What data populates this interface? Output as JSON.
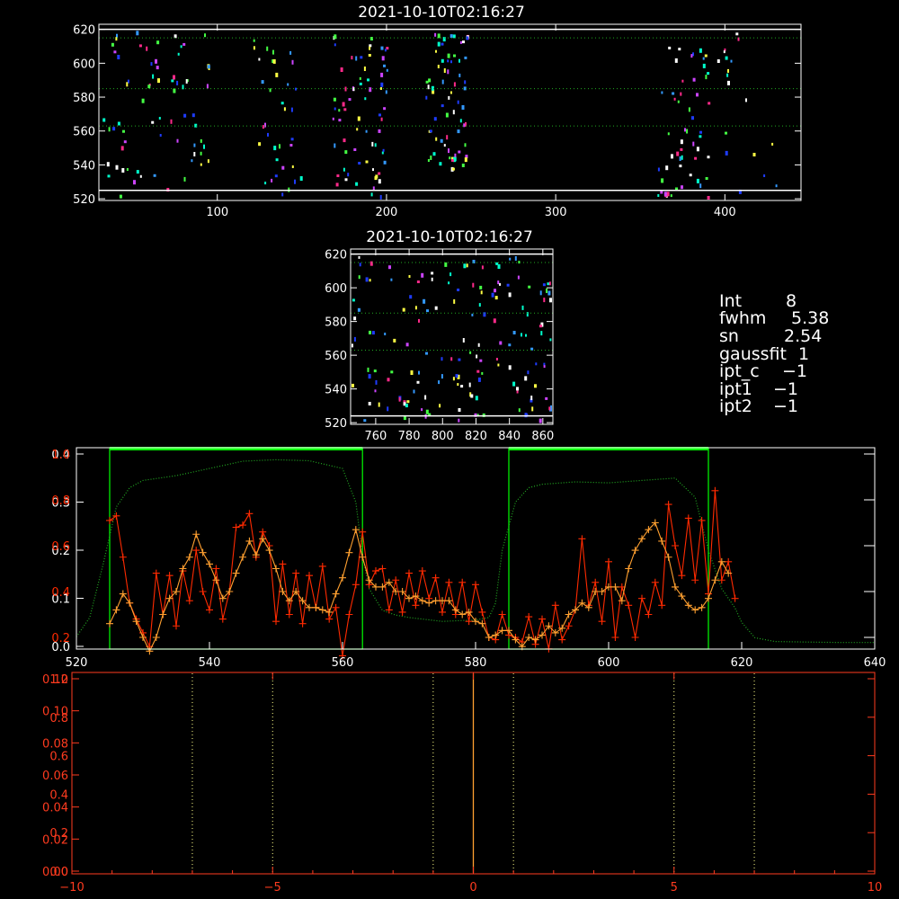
{
  "colors": {
    "background": "#000000",
    "axis_white": "#ffffff",
    "axis_red": "#ff3b1f",
    "guide_green": "#22aa22",
    "box_green": "#00ff00",
    "series_red": "#ff2a00",
    "series_orange": "#ffa030",
    "guide_yellow": "#ffff88",
    "center_orange": "#ffa030",
    "speckle_palette": [
      "#1e3cff",
      "#3399ff",
      "#00ffcc",
      "#44ff44",
      "#cc44ff",
      "#ff2a8a",
      "#ffffff",
      "#ffff44"
    ]
  },
  "info_panel": {
    "lines": [
      {
        "label": "Int",
        "value": "8"
      },
      {
        "label": "fwhm",
        "value": "5.38"
      },
      {
        "label": "sn",
        "value": "2.54"
      },
      {
        "label": "gaussfit",
        "value": "1"
      },
      {
        "label": "ipt_c",
        "value": "−1"
      },
      {
        "label": "ipt1",
        "value": "−1"
      },
      {
        "label": "ipt2",
        "value": "−1"
      }
    ]
  },
  "chart_data": [
    {
      "id": "top-image",
      "type": "heatmap",
      "title": "2021-10-10T02:16:27",
      "xlim": [
        30,
        445
      ],
      "ylim": [
        519,
        623
      ],
      "xticks": [
        100,
        200,
        300,
        400
      ],
      "yticks": [
        520,
        540,
        560,
        580,
        600,
        620
      ],
      "white_lines_y": [
        620,
        525
      ],
      "dotted_green_lines_y": [
        615,
        585,
        563
      ],
      "speckle_columns": [
        {
          "x": [
            30,
            50
          ],
          "y": [
            521,
            620
          ],
          "count": 20
        },
        {
          "x": [
            50,
            95
          ],
          "y": [
            521,
            620
          ],
          "count": 50
        },
        {
          "x": [
            120,
            150
          ],
          "y": [
            521,
            620
          ],
          "count": 35
        },
        {
          "x": [
            168,
            200
          ],
          "y": [
            521,
            620
          ],
          "count": 70
        },
        {
          "x": [
            223,
            248
          ],
          "y": [
            538,
            620
          ],
          "count": 70
        },
        {
          "x": [
            360,
            390
          ],
          "y": [
            521,
            620
          ],
          "count": 55
        },
        {
          "x": [
            395,
            432
          ],
          "y": [
            521,
            620
          ],
          "count": 18
        }
      ]
    },
    {
      "id": "zoom-image",
      "type": "heatmap",
      "title": "2021-10-10T02:16:27",
      "xlim": [
        745,
        866
      ],
      "ylim": [
        519,
        623
      ],
      "xticks": [
        760,
        780,
        800,
        820,
        840,
        860
      ],
      "yticks": [
        520,
        540,
        560,
        580,
        600,
        620
      ],
      "white_lines_y": [
        620,
        524
      ],
      "dotted_green_lines_y": [
        615,
        585,
        563
      ],
      "speckle_count": 160
    },
    {
      "id": "profile-plot",
      "type": "line",
      "xlim": [
        520,
        640
      ],
      "xticks": [
        520,
        540,
        560,
        580,
        600,
        620,
        640
      ],
      "left_axis_white": {
        "ylim": [
          0,
          0.4
        ],
        "ticks": [
          0.0,
          0.1,
          0.2,
          0.3,
          0.4
        ],
        "labels": [
          "0.0",
          "0.1",
          "0.2",
          "0.3",
          "0.4"
        ]
      },
      "left_axis_orange": {
        "ylim": [
          0,
          1.0
        ],
        "ticks": [
          0.2,
          0.4,
          0.6,
          0.8,
          1.0
        ],
        "labels": [
          "0.2",
          "0.4",
          "0.6",
          "0.8",
          "1.0"
        ]
      },
      "green_boxes": [
        [
          525,
          563
        ],
        [
          585,
          615
        ]
      ],
      "series": [
        {
          "style": "dotted-green",
          "x": [
            520,
            522,
            524,
            526,
            528,
            530,
            535,
            540,
            545,
            550,
            555,
            560,
            562,
            563,
            564,
            566,
            568,
            570,
            575,
            580,
            582,
            583,
            584,
            586,
            588,
            590,
            595,
            600,
            605,
            610,
            613,
            615,
            617,
            619,
            620,
            622,
            625,
            630,
            635,
            640
          ],
          "y": [
            0.02,
            0.06,
            0.17,
            0.29,
            0.33,
            0.345,
            0.355,
            0.37,
            0.385,
            0.388,
            0.386,
            0.37,
            0.3,
            0.19,
            0.12,
            0.075,
            0.065,
            0.06,
            0.052,
            0.055,
            0.06,
            0.09,
            0.2,
            0.3,
            0.33,
            0.337,
            0.342,
            0.34,
            0.345,
            0.35,
            0.31,
            0.2,
            0.12,
            0.08,
            0.05,
            0.018,
            0.01,
            0.009,
            0.008,
            0.008
          ]
        },
        {
          "style": "red-plus",
          "x": [
            525,
            526,
            527,
            528,
            529,
            530,
            531,
            532,
            533,
            534,
            535,
            536,
            537,
            538,
            539,
            540,
            541,
            542,
            543,
            544,
            545,
            546,
            547,
            548,
            549,
            550,
            551,
            552,
            553,
            554,
            555,
            556,
            557,
            558,
            559,
            560,
            561,
            562,
            563,
            564,
            565,
            566,
            567,
            568,
            569,
            570,
            571,
            572,
            573,
            574,
            575,
            576,
            577,
            578,
            579,
            580,
            581,
            582,
            583,
            584,
            585,
            586,
            587,
            588,
            589,
            590,
            591,
            592,
            593,
            594,
            595,
            596,
            597,
            598,
            599,
            600,
            601,
            602,
            603,
            604,
            605,
            606,
            607,
            608,
            609,
            610,
            611,
            612,
            613,
            614,
            615,
            616,
            617,
            618,
            619
          ],
          "y": [
            0.71,
            0.73,
            0.55,
            0.35,
            0.28,
            0.22,
            0.16,
            0.48,
            0.3,
            0.47,
            0.25,
            0.49,
            0.36,
            0.58,
            0.4,
            0.32,
            0.5,
            0.28,
            0.4,
            0.68,
            0.69,
            0.74,
            0.55,
            0.66,
            0.6,
            0.27,
            0.52,
            0.3,
            0.48,
            0.26,
            0.47,
            0.33,
            0.51,
            0.28,
            0.33,
            0.12,
            0.3,
            0.43,
            0.66,
            0.43,
            0.49,
            0.5,
            0.32,
            0.45,
            0.31,
            0.48,
            0.34,
            0.49,
            0.37,
            0.46,
            0.31,
            0.44,
            0.3,
            0.44,
            0.27,
            0.43,
            0.31,
            0.2,
            0.19,
            0.3,
            0.21,
            0.2,
            0.18,
            0.29,
            0.17,
            0.28,
            0.15,
            0.34,
            0.19,
            0.25,
            0.32,
            0.63,
            0.34,
            0.44,
            0.27,
            0.53,
            0.2,
            0.42,
            0.34,
            0.2,
            0.37,
            0.3,
            0.44,
            0.34,
            0.78,
            0.6,
            0.47,
            0.72,
            0.45,
            0.71,
            0.39,
            0.84,
            0.45,
            0.53,
            0.37
          ]
        },
        {
          "style": "orange-plus",
          "x": [
            525,
            526,
            527,
            528,
            529,
            530,
            531,
            532,
            533,
            534,
            535,
            536,
            537,
            538,
            539,
            540,
            541,
            542,
            543,
            544,
            545,
            546,
            547,
            548,
            549,
            550,
            551,
            552,
            553,
            554,
            555,
            556,
            557,
            558,
            559,
            560,
            561,
            562,
            563,
            564,
            565,
            566,
            567,
            568,
            569,
            570,
            571,
            572,
            573,
            574,
            575,
            576,
            577,
            578,
            579,
            580,
            581,
            582,
            583,
            584,
            585,
            586,
            587,
            588,
            589,
            590,
            591,
            592,
            593,
            594,
            595,
            596,
            597,
            598,
            599,
            600,
            601,
            602,
            603,
            604,
            605,
            606,
            607,
            608,
            609,
            610,
            611,
            612,
            613,
            614,
            615,
            616,
            617,
            618
          ],
          "y": [
            0.26,
            0.32,
            0.39,
            0.35,
            0.27,
            0.2,
            0.14,
            0.2,
            0.3,
            0.37,
            0.4,
            0.5,
            0.55,
            0.65,
            0.57,
            0.52,
            0.45,
            0.37,
            0.4,
            0.48,
            0.55,
            0.62,
            0.56,
            0.63,
            0.58,
            0.5,
            0.4,
            0.36,
            0.4,
            0.36,
            0.33,
            0.33,
            0.32,
            0.31,
            0.39,
            0.46,
            0.57,
            0.67,
            0.55,
            0.45,
            0.42,
            0.42,
            0.44,
            0.4,
            0.4,
            0.37,
            0.38,
            0.36,
            0.35,
            0.36,
            0.36,
            0.36,
            0.32,
            0.3,
            0.31,
            0.27,
            0.26,
            0.2,
            0.21,
            0.23,
            0.23,
            0.19,
            0.16,
            0.2,
            0.19,
            0.21,
            0.25,
            0.22,
            0.24,
            0.3,
            0.32,
            0.35,
            0.33,
            0.4,
            0.4,
            0.42,
            0.42,
            0.36,
            0.5,
            0.58,
            0.63,
            0.67,
            0.7,
            0.62,
            0.55,
            0.42,
            0.38,
            0.34,
            0.32,
            0.33,
            0.37,
            0.45,
            0.53,
            0.48
          ]
        }
      ]
    },
    {
      "id": "bottom-plot",
      "type": "line",
      "xlim": [
        -10,
        10
      ],
      "xticks": [
        -10,
        -5,
        0,
        5,
        10
      ],
      "xtick_labels": [
        "−10",
        "−5",
        "0",
        "5",
        "10"
      ],
      "left_axis_red": {
        "ylim": [
          0,
          0.12
        ],
        "ticks": [
          0.0,
          0.02,
          0.04,
          0.06,
          0.08,
          0.1,
          0.12
        ],
        "labels": [
          "0.00",
          "0.02",
          "0.04",
          "0.06",
          "0.08",
          "0.10",
          "0.12"
        ]
      },
      "left_axis_orange": {
        "ylim": [
          0,
          1.0
        ],
        "ticks": [
          0.0,
          0.2,
          0.4,
          0.6,
          0.8,
          1.0
        ],
        "labels": [
          "0.0",
          "0.2",
          "0.4",
          "0.6",
          "0.8",
          "1.0"
        ]
      },
      "dotted_lines_x": [
        -7,
        -5,
        -1,
        1,
        5,
        7
      ],
      "center_line_x": 0
    }
  ]
}
